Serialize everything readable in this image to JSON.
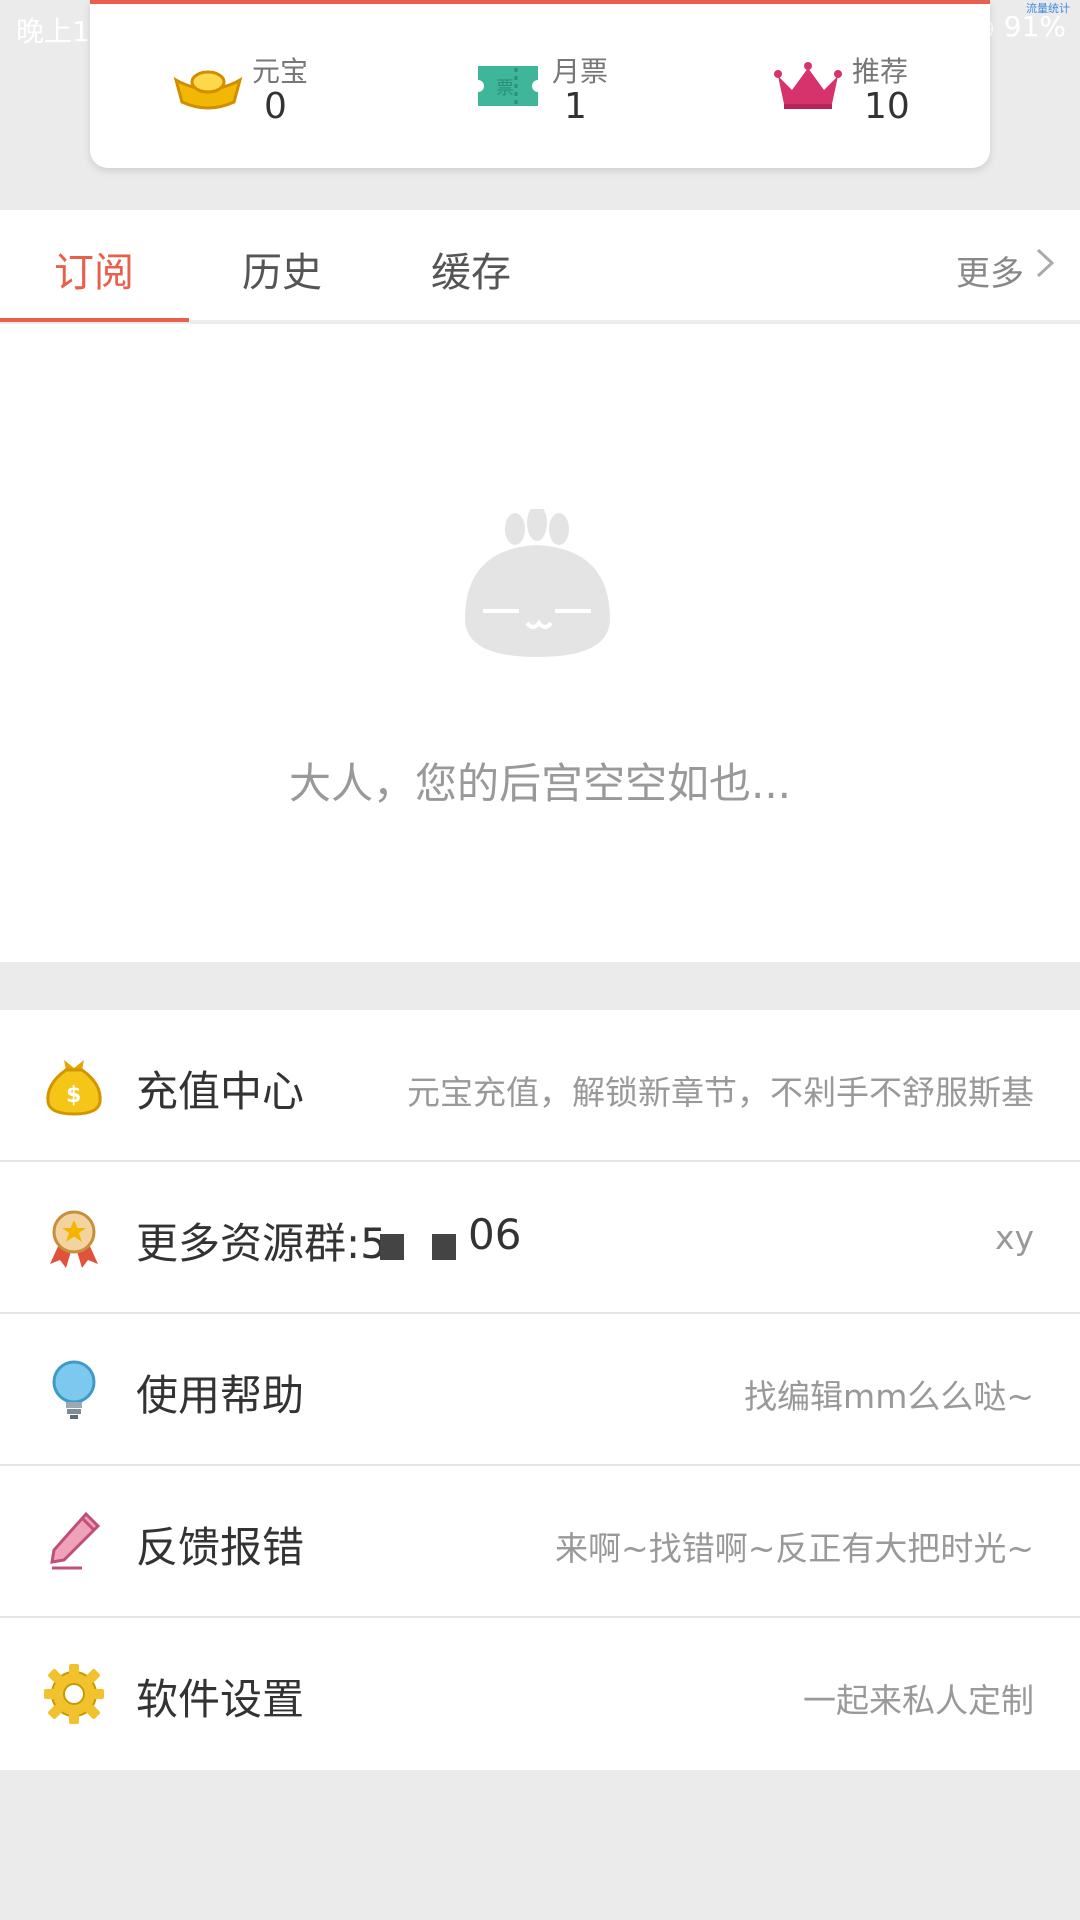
{
  "status_bar": {
    "time": "晚上1(",
    "battery": "◷ 91%",
    "tag": "流量统计"
  },
  "assets": [
    {
      "label": "元宝",
      "value": "0",
      "icon": "gold-ingot-icon"
    },
    {
      "label": "月票",
      "value": "1",
      "icon": "ticket-icon"
    },
    {
      "label": "推荐",
      "value": "10",
      "icon": "crown-icon"
    }
  ],
  "tabs": [
    {
      "label": "订阅",
      "active": true
    },
    {
      "label": "历史",
      "active": false
    },
    {
      "label": "缓存",
      "active": false
    }
  ],
  "tabs_more": "更多",
  "empty_state": {
    "text": "大人，您的后宫空空如也..."
  },
  "menu": [
    {
      "title": "充值中心",
      "subtitle": "元宝充值，解锁新章节，不剁手不舒服斯基",
      "icon": "money-bag-icon"
    },
    {
      "title": "更多资源群:5",
      "title_tail": "06",
      "subtitle": "xy",
      "icon": "award-ribbon-icon"
    },
    {
      "title": "使用帮助",
      "subtitle": "找编辑mm么么哒~",
      "icon": "lightbulb-icon"
    },
    {
      "title": "反馈报错",
      "subtitle": "来啊~找错啊~反正有大把时光~",
      "icon": "pencil-icon"
    },
    {
      "title": "软件设置",
      "subtitle": "一起来私人定制",
      "icon": "gear-icon"
    }
  ],
  "colors": {
    "accent": "#e8604c",
    "background": "#ebebeb"
  }
}
